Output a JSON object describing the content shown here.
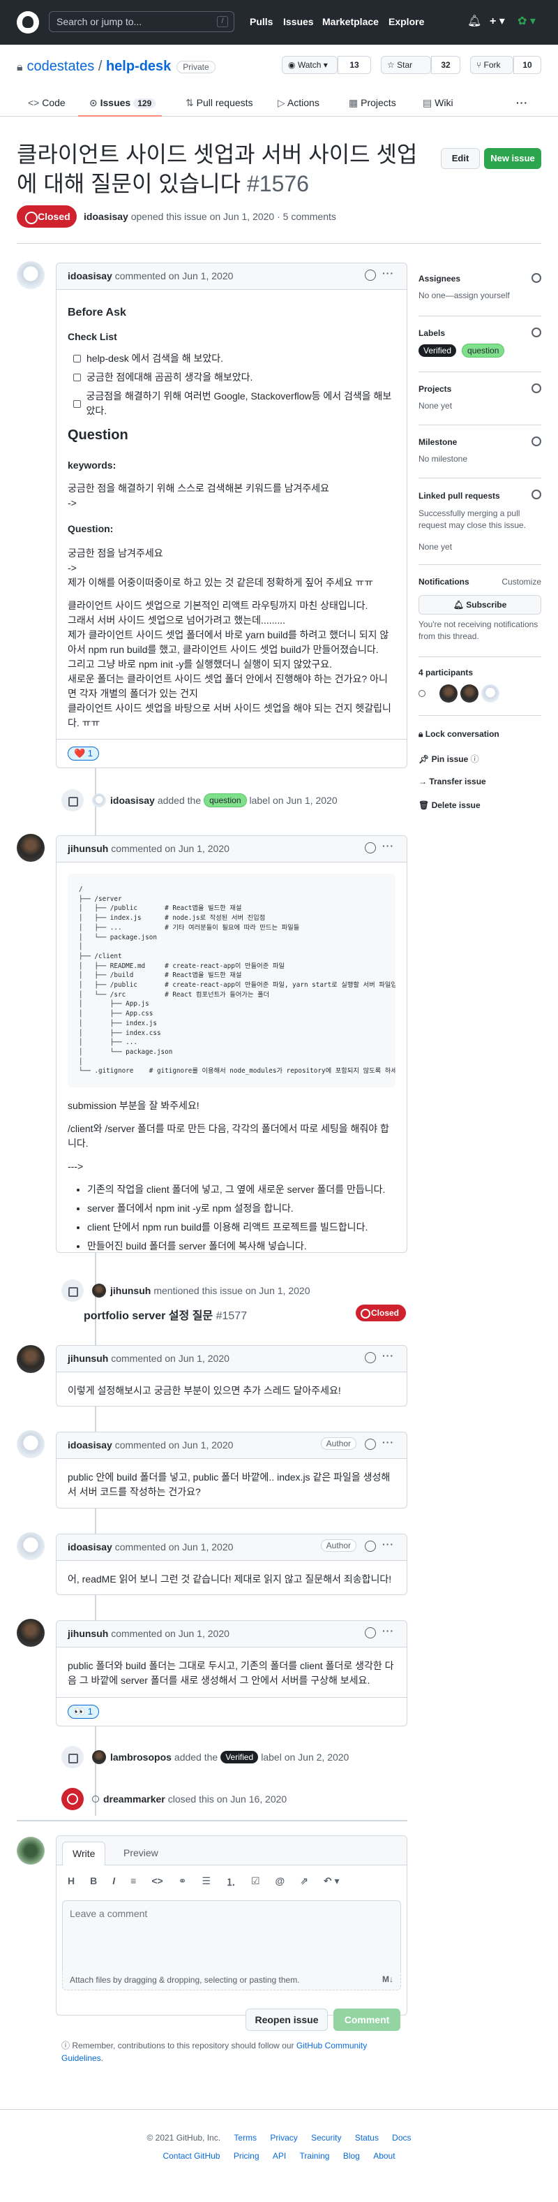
{
  "header": {
    "search_placeholder": "Search or jump to...",
    "slash": "/",
    "nav": [
      "Pulls",
      "Issues",
      "Marketplace",
      "Explore"
    ],
    "bell_icon": "bell-icon",
    "plus_icon": "plus-icon"
  },
  "repo": {
    "owner": "codestates",
    "sep": "/",
    "name": "help-desk",
    "visibility": "Private",
    "watch_label": "Watch",
    "watch_count": "13",
    "star_label": "Star",
    "star_count": "32",
    "fork_label": "Fork",
    "fork_count": "10"
  },
  "tabs": [
    {
      "label": "Code"
    },
    {
      "label": "Issues",
      "count": "129"
    },
    {
      "label": "Pull requests"
    },
    {
      "label": "Actions"
    },
    {
      "label": "Projects"
    },
    {
      "label": "Wiki"
    }
  ],
  "issue": {
    "title": "클라이언트 사이드 셋업과 서버 사이드 셋업에 대해 질문이 있습니다",
    "number": "#1576",
    "edit": "Edit",
    "new_issue": "New issue",
    "state": "Closed",
    "author": "idoasisay",
    "meta": "opened this issue on Jun 1, 2020 · 5 comments"
  },
  "first_comment": {
    "author": "idoasisay",
    "date": "commented on Jun 1, 2020",
    "before_ask": "Before Ask",
    "check_list": "Check List",
    "checks": [
      "help-desk 에서 검색을 해 보았다.",
      "궁금한 점에대해 곰곰히 생각을 해보았다.",
      "궁금점을 해결하기 위해 여러번 Google, Stackoverflow등 에서 검색을 해보았다."
    ],
    "question_h": "Question",
    "keywords_h": "keywords:",
    "keywords_text": "궁금한 점을 해결하기 위해 스스로 검색해본 키워드를 남겨주세요",
    "arrow": "->",
    "question_sub": "Question:",
    "question_text": "궁금한 점을 남겨주세요",
    "question_text2": "제가 이해를 어중이떠중이로 하고 있는 것 같은데 정확하게 짚어 주세요 ㅠㅠ",
    "body_lines": [
      "클라이언트 사이드 셋업으로 기본적인 리액트 라우팅까지 마친 상태입니다.",
      "그래서 서버 사이드 셋업으로 넘어가려고 했는데.........",
      "제가 클라이언트 사이드 셋업 폴더에서 바로 yarn build를 하려고 했더니 되지 않아서 npm run build를 했고, 클라이언트 사이드 셋업 build가 만들어졌습니다.",
      "그리고 그냥 바로 npm init -y를 실행했더니 실행이 되지 않았구요.",
      "새로운 폴더는 클라이언트 사이드 셋업 폴더 안에서 진행해야 하는 건가요? 아니면 각자 개별의 폴더가 있는 건지",
      "클라이언트 사이드 셋업을 바탕으로 서버 사이드 셋업을 해야 되는 건지 헷갈립니다. ㅠㅠ"
    ],
    "reaction": "❤️ 1"
  },
  "label_event": {
    "actor": "idoasisay",
    "pre": "added the",
    "label": "question",
    "post": "label on Jun 1, 2020"
  },
  "second_comment": {
    "author": "jihunsuh",
    "date": "commented on Jun 1, 2020",
    "code": "/\n├── /server\n│   ├── /public       # React앱을 빌드한 재설\n│   ├── index.js      # node.js로 작성된 서버 진입점\n│   ├── ...           # 기타 여러분들이 필요에 따라 만드는 파일들\n│   └── package.json\n│\n├── /client\n│   ├── README.md     # create-react-app이 만들어준 파일\n│   ├── /build        # React앱을 빌드한 재설\n│   ├── /public       # create-react-app이 만들어준 파일, yarn start로 실행할 서버 파일입니다\n│   └── /src          # React 컴포넌트가 들어가는 폴더\n│       ├── App.js\n│       ├── App.css\n│       ├── index.js\n│       ├── index.css\n│       ├── ...\n│       └── package.json\n│\n└── .gitignore    # gitignore를 이용해서 node_modules가 repository에 포함되지 않도록 하세요",
    "p1": "submission 부분을 잘 봐주세요!",
    "p2": "/client와 /server 폴더를 따로 만든 다음, 각각의 폴더에서 따로 세팅을 해줘야 합니다.",
    "arrow": "--->",
    "bullets": [
      "기존의 작업을 client 폴더에 넣고, 그 옆에 새로운 server 폴더를 만듭니다.",
      "server 폴더에서 npm init -y로 npm 설정을 합니다.",
      "client 단에서 npm run build를 이용해 리액트 프로젝트를 빌드합니다.",
      "만들어진 build 폴더를 server 폴더에 복사해 넣습니다."
    ]
  },
  "mention_event": {
    "actor": "jihunsuh",
    "text": "mentioned this issue on Jun 1, 2020",
    "ref_title": "portfolio server 설정 질문",
    "ref_num": "#1577",
    "ref_state": "Closed"
  },
  "third_comment": {
    "author": "jihunsuh",
    "date": "commented on Jun 1, 2020",
    "body": "이렇게 설정해보시고 궁금한 부분이 있으면 추가 스레드 달아주세요!"
  },
  "fourth_comment": {
    "author": "idoasisay",
    "date": "commented on Jun 1, 2020",
    "role": "Author",
    "body": "public 안에 build 폴더를 넣고, public 폴더 바깥에.. index.js 같은 파일을 생성해서 서버 코드를 작성하는 건가요?"
  },
  "fifth_comment": {
    "author": "idoasisay",
    "date": "commented on Jun 1, 2020",
    "role": "Author",
    "body": "어, readME 읽어 보니 그런 것 같습니다! 제대로 읽지 않고 질문해서 죄송합니다!"
  },
  "sixth_comment": {
    "author": "jihunsuh",
    "date": "commented on Jun 1, 2020",
    "body": "public 폴더와 build 폴더는 그대로 두시고, 기존의 폴더를 client 폴더로 생각한 다음 그 바깥에 server 폴더를 새로 생성해서 그 안에서 서버를 구상해 보세요.",
    "reaction": "👀 1"
  },
  "label_event2": {
    "actor": "lambrosopos",
    "pre": "added the",
    "label": "Verified",
    "post": "label on Jun 2, 2020"
  },
  "close_event": {
    "actor": "dreammarker",
    "text": "closed this on Jun 16, 2020"
  },
  "sidebar": {
    "assignees_h": "Assignees",
    "assignees_v": "No one—assign yourself",
    "labels_h": "Labels",
    "labels": [
      "Verified",
      "question"
    ],
    "projects_h": "Projects",
    "projects_v": "None yet",
    "milestone_h": "Milestone",
    "milestone_v": "No milestone",
    "linked_h": "Linked pull requests",
    "linked_desc": "Successfully merging a pull request may close this issue.",
    "linked_v": "None yet",
    "notif_h": "Notifications",
    "notif_customize": "Customize",
    "subscribe": "Subscribe",
    "notif_desc": "You're not receiving notifications from this thread.",
    "participants_h": "4 participants",
    "lock": "Lock conversation",
    "pin": "Pin issue",
    "transfer": "Transfer issue",
    "delete": "Delete issue"
  },
  "form": {
    "write": "Write",
    "preview": "Preview",
    "placeholder": "Leave a comment",
    "attach": "Attach files by dragging & dropping, selecting or pasting them.",
    "reopen": "Reopen issue",
    "comment": "Comment",
    "note_pre": "Remember, contributions to this repository should follow our",
    "note_link": "GitHub Community Guidelines",
    "note_post": "."
  },
  "footer": {
    "copyright": "© 2021 GitHub, Inc.",
    "row1": [
      "Terms",
      "Privacy",
      "Security",
      "Status",
      "Docs"
    ],
    "row2": [
      "Contact GitHub",
      "Pricing",
      "API",
      "Training",
      "Blog",
      "About"
    ]
  },
  "colors": {
    "closed": "#cf222e",
    "primary": "#2da44e",
    "link": "#0969da",
    "header_bg": "#24292f"
  }
}
